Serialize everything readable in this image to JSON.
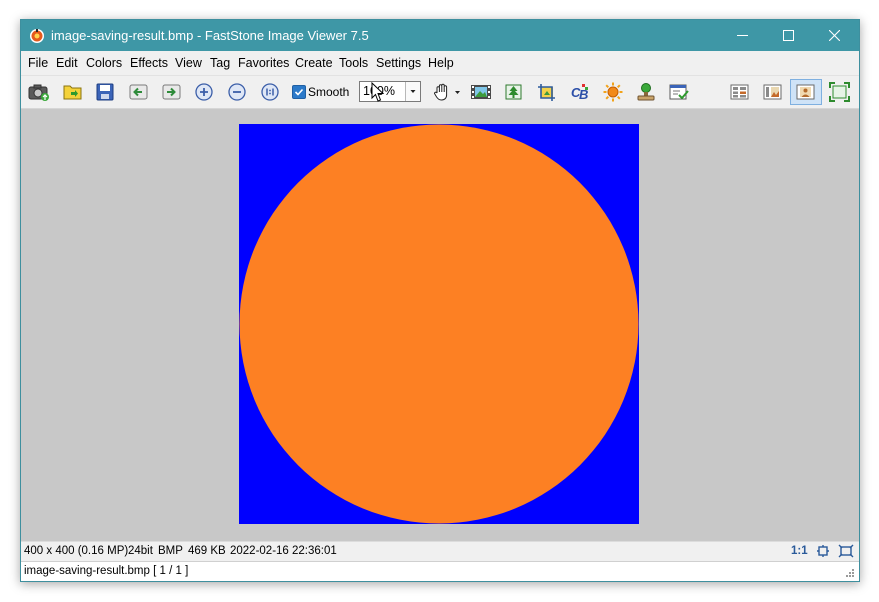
{
  "window": {
    "title": "image-saving-result.bmp  -  FastStone Image Viewer 7.5",
    "icon": "faststone-app-icon"
  },
  "menu": [
    "File",
    "Edit",
    "Colors",
    "Effects",
    "View",
    "Tag",
    "Favorites",
    "Create",
    "Tools",
    "Settings",
    "Help"
  ],
  "toolbar": {
    "smooth_label": "Smooth",
    "smooth_checked": true,
    "zoom_value": "100%"
  },
  "image": {
    "background_color": "#0000ff",
    "circle_color": "#fd8023"
  },
  "status": {
    "dimensions": "400 x 400 (0.16 MP)",
    "bit_depth": "24bit",
    "format": "BMP",
    "file_size": "469 KB",
    "datetime": "2022-02-16 22:36:01",
    "ratio": "1:1",
    "filename_index": "image-saving-result.bmp [ 1 / 1 ]"
  },
  "colors": {
    "titlebar": "#3e97a6",
    "viewer_bg": "#c8c8c8"
  }
}
